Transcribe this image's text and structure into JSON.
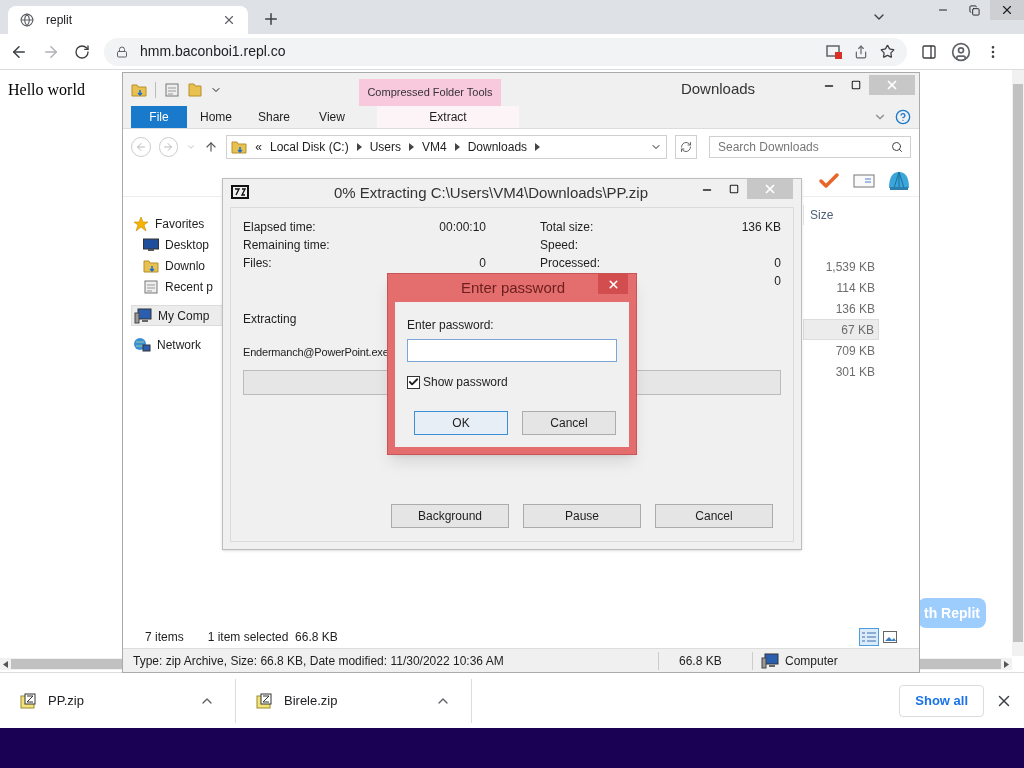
{
  "browser": {
    "tab_title": "replit",
    "url": "hmm.baconboi1.repl.co",
    "page_text": "Hello world",
    "page_button": "th Replit",
    "downloads": [
      {
        "name": "PP.zip"
      },
      {
        "name": "Birele.zip"
      }
    ],
    "show_all": "Show all"
  },
  "explorer": {
    "title": "Downloads",
    "context_tab": "Compressed Folder Tools",
    "file_tab": "File",
    "ribbon_tabs": [
      {
        "label": "Home",
        "selected": false
      },
      {
        "label": "Share",
        "selected": false
      },
      {
        "label": "View",
        "selected": false
      },
      {
        "label": "Extract",
        "selected": false
      }
    ],
    "breadcrumb_prefix": "«",
    "breadcrumb": [
      "Local Disk (C:)",
      "Users",
      "VM4",
      "Downloads"
    ],
    "search": {
      "placeholder": "Search Downloads"
    },
    "nav": [
      {
        "label": "Favorites",
        "kind": "star",
        "selected": false,
        "children": [
          {
            "label": "Desktop",
            "kind": "desktop",
            "selected": false
          },
          {
            "label": "Downlo",
            "kind": "folder",
            "selected": false
          },
          {
            "label": "Recent p",
            "kind": "recent",
            "selected": false
          }
        ]
      },
      {
        "label": "My Comp",
        "kind": "computer",
        "selected": true
      },
      {
        "label": "Network",
        "kind": "network",
        "selected": false
      }
    ],
    "size_header": "Size",
    "sizes": [
      {
        "value": "1,539 KB",
        "selected": false
      },
      {
        "value": "114 KB",
        "selected": false
      },
      {
        "value": "136 KB",
        "selected": false
      },
      {
        "value": "67 KB",
        "selected": true
      },
      {
        "value": "709 KB",
        "selected": false
      },
      {
        "value": "301 KB",
        "selected": false
      }
    ],
    "item_count": "7 items",
    "selection": "1 item selected  66.8 KB",
    "details": "Type: zip Archive, Size: 66.8 KB, Date modified: 11/30/2022 10:36 AM",
    "details_size": "66.8 KB",
    "details_location": "Computer"
  },
  "progress": {
    "title": "0% Extracting C:\\Users\\VM4\\Downloads\\PP.zip",
    "left": [
      {
        "label": "Elapsed time:",
        "value": "00:00:10"
      },
      {
        "label": "Remaining time:"
      },
      {
        "label": "Files:",
        "value": "0"
      }
    ],
    "right": [
      {
        "label": "Total size:",
        "value": "136 KB"
      },
      {
        "label": "Speed:"
      },
      {
        "label": "Processed:",
        "value": "0"
      },
      {
        "value": "0"
      }
    ],
    "status": "Extracting",
    "file": "Endermanch@PowerPoint.exe",
    "level": 0,
    "buttons": [
      "Background",
      "Pause",
      "Cancel"
    ]
  },
  "password": {
    "title": "Enter password",
    "label": "Enter password:",
    "show_password": {
      "label": "Show password",
      "checked": true
    },
    "buttons": [
      {
        "label": "OK",
        "focused": true
      },
      {
        "label": "Cancel",
        "focused": false
      }
    ]
  }
}
